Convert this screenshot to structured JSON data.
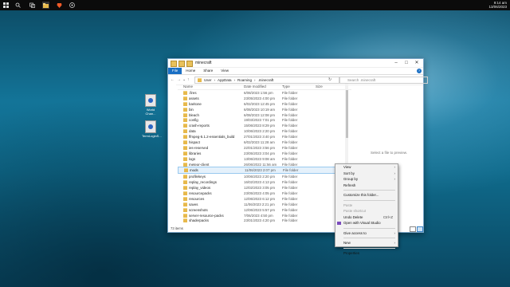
{
  "taskbar": {
    "icons": [
      "windows-icon",
      "search-icon",
      "task-view-icon",
      "file-explorer-icon",
      "brave-browser-icon",
      "obs-icon"
    ],
    "time": "9:14 am",
    "date": "13/06/2023"
  },
  "desktop_icons": [
    {
      "label": "World Chan..."
    },
    {
      "label": "TermLoginS..."
    }
  ],
  "window": {
    "title": "minecraft",
    "ribbon_tabs": [
      "File",
      "Home",
      "Share",
      "View"
    ],
    "address": [
      "User",
      "AppData",
      "Roaming",
      ".minecraft"
    ],
    "search_placeholder": "Search .minecraft",
    "columns": [
      "Name",
      "Date modified",
      "Type",
      "Size"
    ],
    "rows": [
      {
        "name": ".fires",
        "date": "6/08/2023 1:56 pm",
        "type": "File folder"
      },
      {
        "name": "assets",
        "date": "23/05/2023 4:00 pm",
        "type": "File folder"
      },
      {
        "name": "baritone",
        "date": "6/02/2023 12:45 pm",
        "type": "File folder"
      },
      {
        "name": "bin",
        "date": "6/08/2023 10:19 am",
        "type": "File folder"
      },
      {
        "name": "bleach",
        "date": "6/08/2023 12:08 pm",
        "type": "File folder"
      },
      {
        "name": "config",
        "date": "19/03/2023 7:01 pm",
        "type": "File folder"
      },
      {
        "name": "crash-reports",
        "date": "15/06/2023 8:29 pm",
        "type": "File folder"
      },
      {
        "name": "data",
        "date": "10/06/2023 2:20 pm",
        "type": "File folder"
      },
      {
        "name": "ffmpeg-5.1.2-essentials_build",
        "date": "27/01/2023 3:40 pm",
        "type": "File folder"
      },
      {
        "name": "hispact",
        "date": "6/02/2023 11:28 am",
        "type": "File folder"
      },
      {
        "name": "ies-reserved",
        "date": "22/01/2023 3:56 pm",
        "type": "File folder"
      },
      {
        "name": "libraries",
        "date": "23/05/2023 3:04 pm",
        "type": "File folder"
      },
      {
        "name": "logs",
        "date": "13/06/2023 9:08 am",
        "type": "File folder"
      },
      {
        "name": "meteor-client",
        "date": "26/06/2022 11:56 am",
        "type": "File folder"
      },
      {
        "name": "mods",
        "date": "11/06/2023 2:07 pm",
        "type": "File folder"
      },
      {
        "name": "profilekeys",
        "date": "10/06/2023 2:20 pm",
        "type": "File folder"
      },
      {
        "name": "replay_recordings",
        "date": "16/02/2023 4:13 pm",
        "type": "File folder"
      },
      {
        "name": "replay_videos",
        "date": "12/02/2023 3:05 pm",
        "type": "File folder"
      },
      {
        "name": "resourcepacks",
        "date": "23/05/2023 4:05 pm",
        "type": "File folder"
      },
      {
        "name": "resources",
        "date": "12/06/2023 6:12 pm",
        "type": "File folder"
      },
      {
        "name": "saves",
        "date": "11/06/2023 2:21 pm",
        "type": "File folder"
      },
      {
        "name": "screenshots",
        "date": "12/06/2023 5:57 pm",
        "type": "File folder"
      },
      {
        "name": "server-resource-packs",
        "date": "7/06/2023 4:50 pm",
        "type": "File folder"
      },
      {
        "name": "shaderpacks",
        "date": "23/01/2023 4:20 pm",
        "type": "File folder"
      }
    ],
    "selected_row": "mods",
    "preview_text": "Select a file to preview.",
    "status": "73 items"
  },
  "context_menu": {
    "items": [
      {
        "label": "View",
        "arrow": true
      },
      {
        "label": "Sort by",
        "arrow": true
      },
      {
        "label": "Group by",
        "arrow": true
      },
      {
        "label": "Refresh"
      },
      {
        "sep": true
      },
      {
        "label": "Customize this folder..."
      },
      {
        "sep": true
      },
      {
        "label": "Paste",
        "disabled": true
      },
      {
        "label": "Paste shortcut",
        "disabled": true
      },
      {
        "label": "Undo Delete",
        "accel": "Ctrl+Z"
      },
      {
        "label": "Open with Visual Studio",
        "icon": "visual-studio-icon"
      },
      {
        "sep": true
      },
      {
        "label": "Give access to",
        "arrow": true
      },
      {
        "sep": true
      },
      {
        "label": "New",
        "arrow": true
      },
      {
        "sep": true
      },
      {
        "label": "Properties"
      }
    ]
  }
}
